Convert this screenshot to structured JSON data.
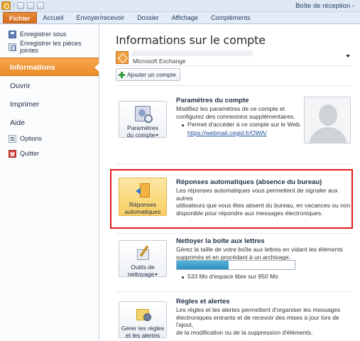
{
  "window": {
    "title": "Boîte de réception -"
  },
  "tabs": [
    "Fichier",
    "Accueil",
    "Envoyer/recevoir",
    "Dossier",
    "Affichage",
    "Compléments"
  ],
  "nav": {
    "save_as": "Enregistrer sous",
    "save_attachments": "Enregistrer les pièces jointes",
    "info": "Informations",
    "open": "Ouvrir",
    "print": "Imprimer",
    "help": "Aide",
    "options": "Options",
    "quit": "Quitter"
  },
  "main": {
    "title": "Informations sur le compte",
    "account_type": "Microsoft Exchange",
    "add_account": "Ajouter un compte"
  },
  "sections": {
    "account_settings": {
      "button_line1": "Paramètres",
      "button_line2": "du compte",
      "title": "Paramètres du compte",
      "text_line1": "Modifiez les paramètres de ce compte et",
      "text_line2": "configurez des connexions supplémentaires.",
      "bullet": "Permet d'accéder à ce compte sur le Web.",
      "link": "https://webmail.cegid.fr/OWA/"
    },
    "auto_replies": {
      "button_line1": "Réponses",
      "button_line2": "automatiques",
      "title": "Réponses automatiques (absence du bureau)",
      "text_line1": "Les réponses automatiques vous permettent de signaler aux autres",
      "text_line2": "utilisateurs que vous êtes absent du bureau, en vacances ou non",
      "text_line3": "disponible pour répondre aux messages électroniques."
    },
    "cleanup": {
      "button_line1": "Outils de",
      "button_line2": "nettoyage",
      "title": "Nettoyer la boîte aux lettres",
      "text_line1": "Gérez la taille de votre boîte aux lettres en vidant les éléments",
      "text_line2": "supprimés et en procédant à un archivage.",
      "storage_text": "533 Mo d'espace libre sur 950 Mo",
      "storage_used_fraction": 0.44
    },
    "rules": {
      "button_line1": "Gérer les règles",
      "button_line2": "et les alertes",
      "title": "Règles et alertes",
      "text_line1": "Les règles et les alertes permettent d'organiser les messages",
      "text_line2": "électroniques entrants et de recevoir des mises à jour lors de l'ajout,",
      "text_line3": "de la modification ou de la suppression d'éléments."
    }
  },
  "colors": {
    "file_tab": "#d4681a",
    "active_nav": "#ea8c2a",
    "highlight_outline": "#e01b1b",
    "storage_fill": "#2e8dbc"
  }
}
